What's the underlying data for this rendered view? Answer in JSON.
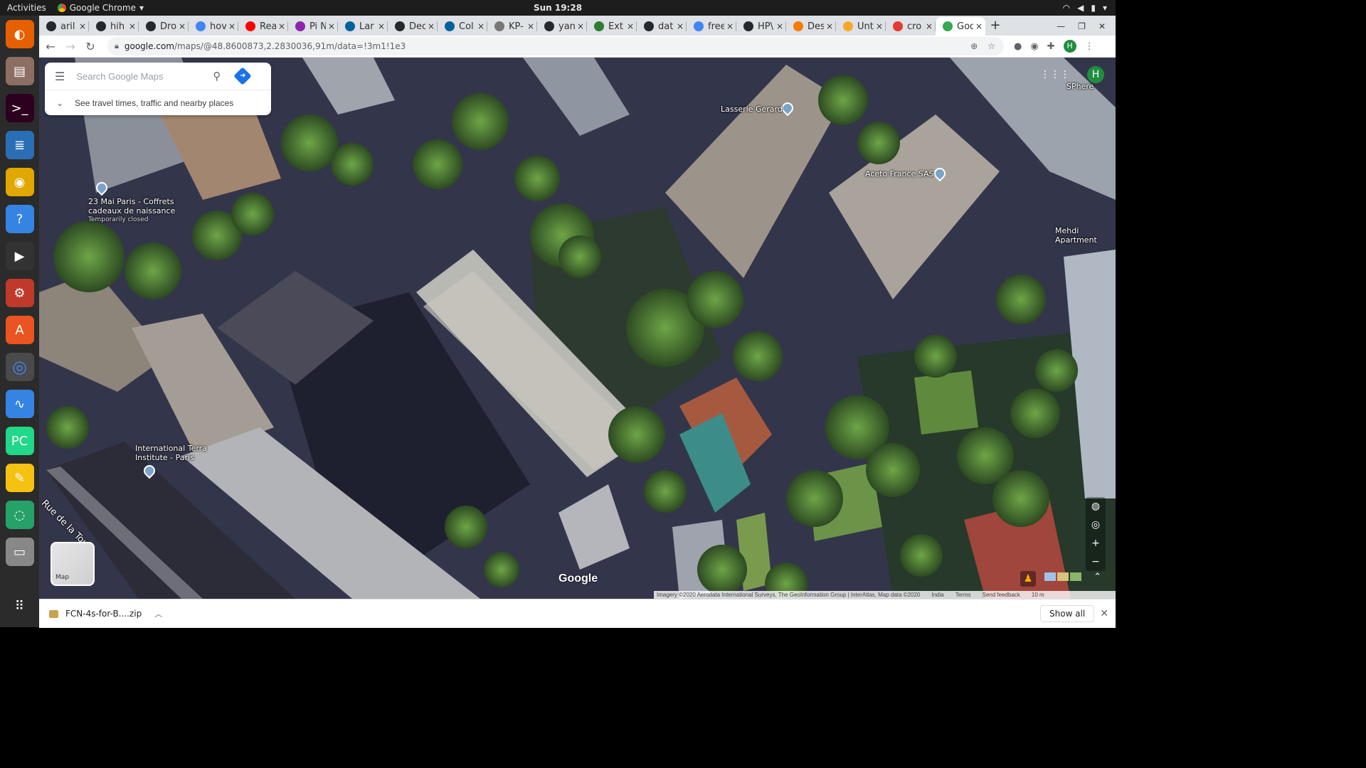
{
  "topbar": {
    "activities": "Activities",
    "app_name": "Google Chrome",
    "app_arrow": "▾",
    "clock": "Sun 19:28"
  },
  "dock": [
    {
      "name": "firefox-icon",
      "color": "#e66000"
    },
    {
      "name": "files-icon",
      "color": "#8d6e63"
    },
    {
      "name": "terminal-icon",
      "color": "#2c001e"
    },
    {
      "name": "writer-icon",
      "color": "#2a6fb5"
    },
    {
      "name": "rhythmbox-icon",
      "color": "#e0a800"
    },
    {
      "name": "help-icon",
      "color": "#3584e4"
    },
    {
      "name": "video-editor-icon",
      "color": "#333333"
    },
    {
      "name": "settings-icon",
      "color": "#c0392b"
    },
    {
      "name": "software-icon",
      "color": "#e95420"
    },
    {
      "name": "chrome-icon",
      "color": "#4285f4",
      "active": true
    },
    {
      "name": "system-monitor-icon",
      "color": "#3584e4"
    },
    {
      "name": "pycharm-icon",
      "color": "#21d789"
    },
    {
      "name": "text-editor-icon",
      "color": "#f5c211"
    },
    {
      "name": "sync-icon",
      "color": "#26a269"
    },
    {
      "name": "scanner-icon",
      "color": "#888888"
    },
    {
      "name": "app-grid-icon",
      "color": "#2b2b2b"
    }
  ],
  "tabs": [
    {
      "label": "aril",
      "icon": "github-icon",
      "color": "#24292e"
    },
    {
      "label": "hih",
      "icon": "github-icon",
      "color": "#24292e"
    },
    {
      "label": "Dro",
      "icon": "github-icon",
      "color": "#24292e"
    },
    {
      "label": "hov",
      "icon": "google-icon",
      "color": "#4285f4"
    },
    {
      "label": "Rea",
      "icon": "youtube-icon",
      "color": "#ff0000"
    },
    {
      "label": "Pi N",
      "icon": "pi-icon",
      "color": "#8e24aa"
    },
    {
      "label": "Lar",
      "icon": "ieee-icon",
      "color": "#00629b"
    },
    {
      "label": "Dec",
      "icon": "github-icon",
      "color": "#24292e"
    },
    {
      "label": "Col",
      "icon": "ieee-icon",
      "color": "#00629b"
    },
    {
      "label": "KP-",
      "icon": "web-icon",
      "color": "#777777"
    },
    {
      "label": "yan",
      "icon": "github-icon",
      "color": "#24292e"
    },
    {
      "label": "Ext",
      "icon": "globe-icon",
      "color": "#2e7d32"
    },
    {
      "label": "dat",
      "icon": "github-icon",
      "color": "#24292e"
    },
    {
      "label": "free",
      "icon": "google-icon",
      "color": "#4285f4"
    },
    {
      "label": "HP\\",
      "icon": "github-icon",
      "color": "#24292e"
    },
    {
      "label": "Des",
      "icon": "arc-icon",
      "color": "#f57c00"
    },
    {
      "label": "Unt",
      "icon": "notebook-icon",
      "color": "#f9a825"
    },
    {
      "label": "cro",
      "icon": "infinity-icon",
      "color": "#e53935"
    },
    {
      "label": "Goo",
      "icon": "maps-icon",
      "color": "#34a853",
      "active": true
    }
  ],
  "tab_close": "×",
  "toolbar": {
    "url_host": "google.com",
    "url_path": "/maps/@48.8600873,2.2830036,91m/data=!3m1!1e3"
  },
  "search": {
    "placeholder": "Search Google Maps",
    "subtitle": "See travel times, traffic and nearby places"
  },
  "map": {
    "avatar_letter": "H",
    "pois": [
      {
        "name": "Lasserie Gerard",
        "sub": ""
      },
      {
        "name": "Aceto France SAS",
        "sub": ""
      },
      {
        "name": "23 Mai Paris - Coffrets cadeaux de naissance",
        "sub": "Temporarily closed"
      },
      {
        "name": "International Terra Institute - Paris",
        "sub": ""
      },
      {
        "name": "SPhere",
        "sub": ""
      },
      {
        "name": "Mehdi Apartment",
        "sub": ""
      },
      {
        "name": "Rue de la Tour",
        "sub": ""
      }
    ],
    "layer_label": "Map",
    "logo": "Google",
    "attribution": [
      "Imagery ©2020 Aerodata International Surveys, The GeoInformation Group | InterAtlas, Map data ©2020",
      "India",
      "Terms",
      "Send feedback",
      "10 m"
    ]
  },
  "download": {
    "filename": "FCN-4s-for-B....zip",
    "show_all": "Show all"
  }
}
